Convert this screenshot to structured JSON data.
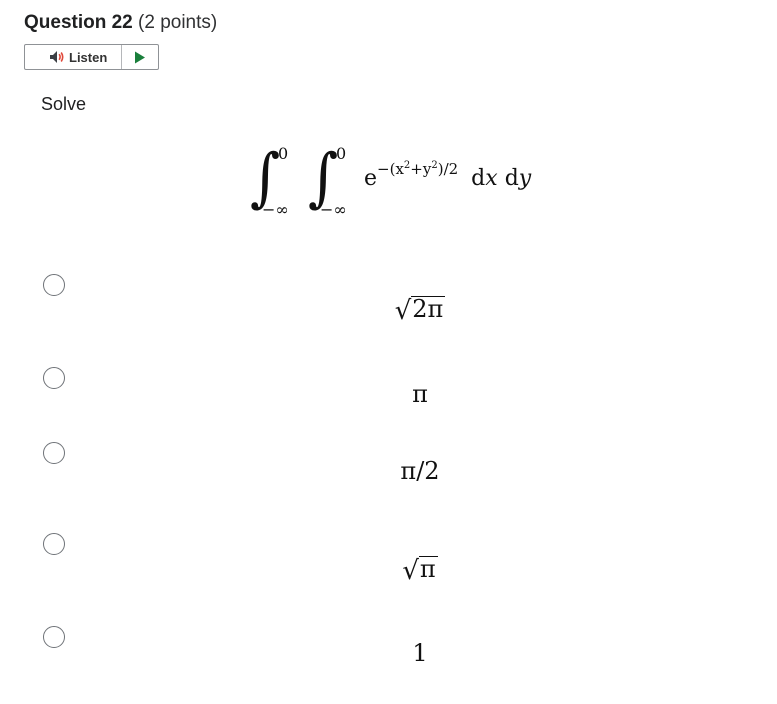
{
  "question": {
    "label": "Question 22",
    "points": "(2 points)"
  },
  "listen": {
    "label": "Listen",
    "speaker_icon": "speaker-icon",
    "play_icon": "play-icon"
  },
  "prompt": "Solve",
  "integral": {
    "upper_limit_1": "0",
    "lower_limit_1": "−∞",
    "upper_limit_2": "0",
    "lower_limit_2": "−∞",
    "base": "e",
    "exponent_pre": "−(x",
    "exponent_sup1": "2",
    "exponent_mid": "+y",
    "exponent_sup2": "2",
    "exponent_post": ")/2",
    "differential_d1": "d",
    "differential_x": "x",
    "differential_d2": "d",
    "differential_y": "y"
  },
  "options": [
    {
      "radical": "√",
      "radicand": "2π",
      "selected": false
    },
    {
      "text": "π",
      "selected": false
    },
    {
      "text": "π/2",
      "selected": false
    },
    {
      "radical": "√",
      "radicand": "π",
      "selected": false
    },
    {
      "text": "1",
      "selected": false
    }
  ],
  "colors": {
    "text": "#202122",
    "border": "#8f9296",
    "play_accent": "#1a7f3c"
  }
}
